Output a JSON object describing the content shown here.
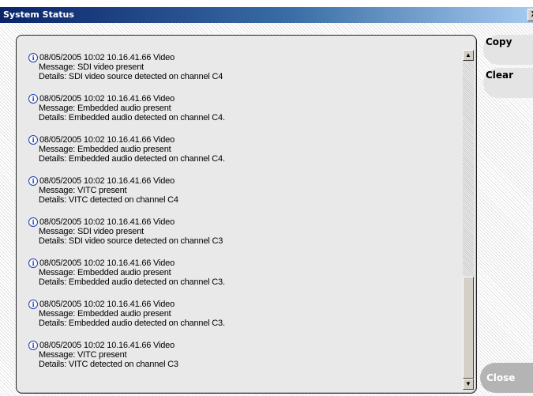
{
  "window": {
    "title": "System Status",
    "close_glyph": "X"
  },
  "buttons": {
    "copy": "Copy",
    "clear": "Clear",
    "close": "Close"
  },
  "scrollbar": {
    "up_icon": "scroll-up-arrow-icon",
    "down_icon": "scroll-down-arrow-icon",
    "position_fraction": 0.68,
    "visible_fraction": 0.32
  },
  "colors": {
    "title_start": "#0a246a",
    "title_end": "#a6caf0",
    "panel_bg": "#e9e9e9",
    "info_icon": "#1e3cb4"
  },
  "log": [
    {
      "header": "08/05/2005 10:02 10.16.41.66 Video",
      "message": "Message: SDI video present",
      "details": "Details: SDI video source detected on channel C4"
    },
    {
      "header": "08/05/2005 10:02 10.16.41.66 Video",
      "message": "Message: Embedded audio present",
      "details": "Details: Embedded audio detected on channel C4."
    },
    {
      "header": "08/05/2005 10:02 10.16.41.66 Video",
      "message": "Message: Embedded audio present",
      "details": "Details: Embedded audio detected on channel C4."
    },
    {
      "header": "08/05/2005 10:02 10.16.41.66 Video",
      "message": "Message: VITC present",
      "details": "Details: VITC detected on channel C4"
    },
    {
      "header": "08/05/2005 10:02 10.16.41.66 Video",
      "message": "Message: SDI video present",
      "details": "Details: SDI video source detected on channel C3"
    },
    {
      "header": "08/05/2005 10:02 10.16.41.66 Video",
      "message": "Message: Embedded audio present",
      "details": "Details: Embedded audio detected on channel C3."
    },
    {
      "header": "08/05/2005 10:02 10.16.41.66 Video",
      "message": "Message: Embedded audio present",
      "details": "Details: Embedded audio detected on channel C3."
    },
    {
      "header": "08/05/2005 10:02 10.16.41.66 Video",
      "message": "Message: VITC present",
      "details": "Details: VITC detected on channel C3"
    }
  ]
}
